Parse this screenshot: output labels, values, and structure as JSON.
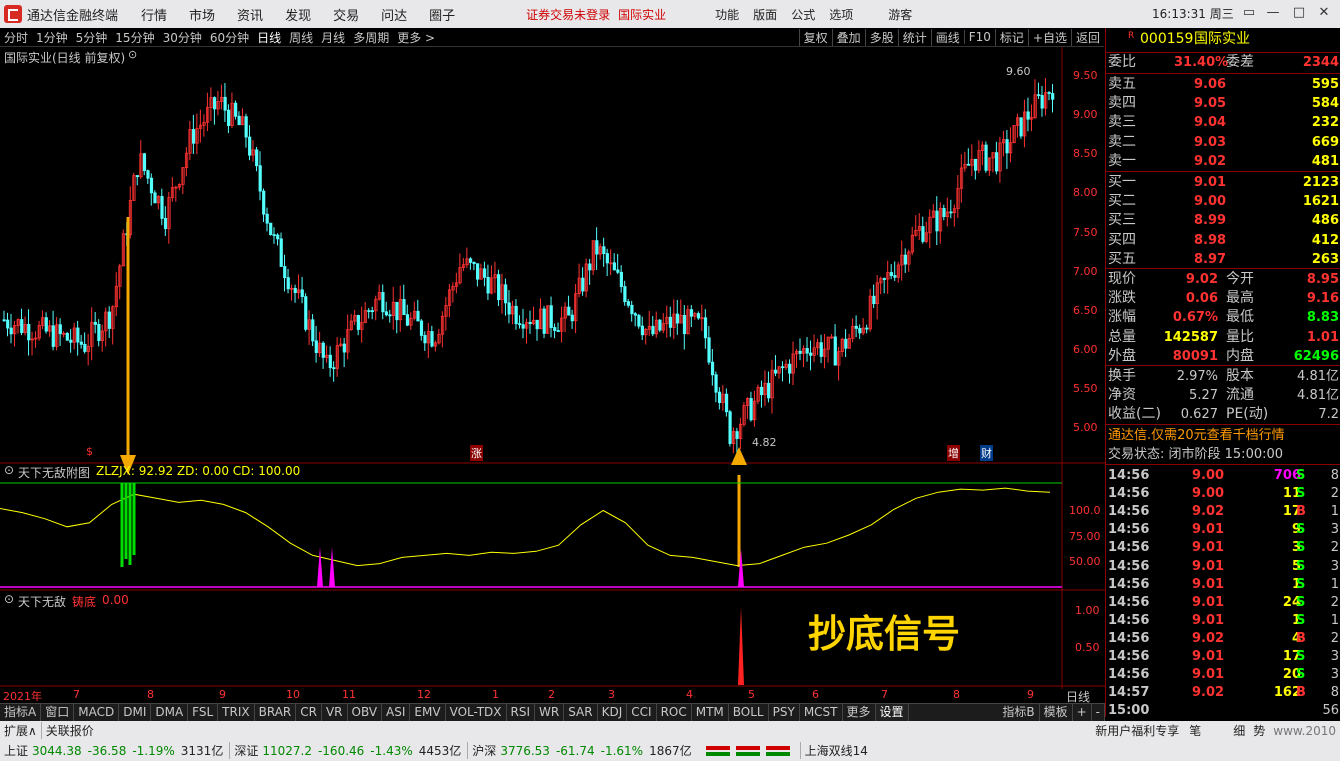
{
  "menubar": {
    "app_title": "通达信金融终端",
    "items": [
      "行情",
      "市场",
      "资讯",
      "发现",
      "交易",
      "问达",
      "圈子"
    ],
    "warning": "证券交易未登录",
    "stock_link": "国际实业",
    "right_items": [
      "功能",
      "版面",
      "公式",
      "选项"
    ],
    "guest": "游客",
    "clock": "16:13:31 周三",
    "win_buttons": [
      "▭",
      "—",
      "□",
      "✕"
    ]
  },
  "toolbar": {
    "periods": [
      "分时",
      "1分钟",
      "5分钟",
      "15分钟",
      "30分钟",
      "60分钟",
      "日线",
      "周线",
      "月线",
      "多周期",
      "更多 >"
    ],
    "active_period": "日线",
    "tools": [
      "复权",
      "叠加",
      "多股",
      "统计",
      "画线",
      "F10",
      "标记",
      "+自选",
      "返回"
    ]
  },
  "chart": {
    "title": "国际实业(日线 前复权)",
    "price_axis": [
      "9.50",
      "9.00",
      "8.50",
      "8.00",
      "7.50",
      "7.00",
      "6.50",
      "6.00",
      "5.50",
      "5.00"
    ],
    "high_label": "9.60",
    "low_label": "4.82",
    "event_markers": [
      "$",
      "涨",
      "增",
      "财"
    ],
    "sub1_title": "天下无敌附图",
    "sub1_values": "ZLZJX: 92.92  ZD: 0.00  CD: 100.00",
    "sub1_axis": [
      "100.0",
      "75.00",
      "50.00"
    ],
    "sub2_title": "天下无敌",
    "sub2_name": "铸底",
    "sub2_value": "0.00",
    "sub2_axis": [
      "1.00",
      "0.50"
    ],
    "signal_text": "抄底信号",
    "date_axis": [
      "2021年",
      "7",
      "8",
      "9",
      "10",
      "11",
      "12",
      "1",
      "2",
      "3",
      "4",
      "5",
      "6",
      "7",
      "8",
      "9"
    ],
    "period_label": "日线"
  },
  "chart_data": {
    "type": "candlestick",
    "title": "国际实业(日线 前复权)",
    "ylim": [
      4.8,
      9.75
    ],
    "high": 9.6,
    "low": 4.82,
    "x_labels": [
      "2021年",
      "7",
      "8",
      "9",
      "10",
      "11",
      "12",
      "1",
      "2",
      "3",
      "4",
      "5",
      "6",
      "7",
      "8",
      "9"
    ],
    "close_trend": [
      6.3,
      6.2,
      6.1,
      6.0,
      6.4,
      8.3,
      7.6,
      8.6,
      9.0,
      8.6,
      7.3,
      6.5,
      5.7,
      6.2,
      6.6,
      6.3,
      6.1,
      7.0,
      6.8,
      6.4,
      6.3,
      6.3,
      7.2,
      6.7,
      6.1,
      6.3,
      6.2,
      4.9,
      5.3,
      5.7,
      6.0,
      5.9,
      6.3,
      6.9,
      7.4,
      7.6,
      8.3,
      8.3,
      8.8,
      9.2
    ]
  },
  "quote": {
    "code": "000159",
    "name": "国际实业",
    "r_tag": "R",
    "weibi_label": "委比",
    "weibi": "31.40%",
    "weicha_label": "委差",
    "weicha": "2344",
    "asks": [
      {
        "label": "卖五",
        "price": "9.06",
        "vol": "595"
      },
      {
        "label": "卖四",
        "price": "9.05",
        "vol": "584"
      },
      {
        "label": "卖三",
        "price": "9.04",
        "vol": "232"
      },
      {
        "label": "卖二",
        "price": "9.03",
        "vol": "669"
      },
      {
        "label": "卖一",
        "price": "9.02",
        "vol": "481"
      }
    ],
    "bids": [
      {
        "label": "买一",
        "price": "9.01",
        "vol": "2123"
      },
      {
        "label": "买二",
        "price": "9.00",
        "vol": "1621"
      },
      {
        "label": "买三",
        "price": "8.99",
        "vol": "486"
      },
      {
        "label": "买四",
        "price": "8.98",
        "vol": "412"
      },
      {
        "label": "买五",
        "price": "8.97",
        "vol": "263"
      }
    ],
    "stats": [
      {
        "l1": "现价",
        "v1": "9.02",
        "l2": "今开",
        "v2": "8.95"
      },
      {
        "l1": "涨跌",
        "v1": "0.06",
        "l2": "最高",
        "v2": "9.16"
      },
      {
        "l1": "涨幅",
        "v1": "0.67%",
        "l2": "最低",
        "v2": "8.83"
      },
      {
        "l1": "总量",
        "v1": "142587",
        "l2": "量比",
        "v2": "1.01"
      },
      {
        "l1": "外盘",
        "v1": "80091",
        "l2": "内盘",
        "v2": "62496"
      }
    ],
    "stats2": [
      {
        "l1": "换手",
        "v1": "2.97%",
        "l2": "股本",
        "v2": "4.81亿"
      },
      {
        "l1": "净资",
        "v1": "5.27",
        "l2": "流通",
        "v2": "4.81亿"
      },
      {
        "l1": "收益(二)",
        "v1": "0.627",
        "l2": "PE(动)",
        "v2": "7.2"
      }
    ],
    "promo": "通达信.仅需20元查看千档行情",
    "trade_status": "交易状态: 闭市阶段 15:00:00",
    "ticks": [
      {
        "t": "14:56",
        "p": "9.00",
        "v": "706",
        "bs": "S",
        "n": "8"
      },
      {
        "t": "14:56",
        "p": "9.00",
        "v": "11",
        "bs": "S",
        "n": "2"
      },
      {
        "t": "14:56",
        "p": "9.02",
        "v": "17",
        "bs": "B",
        "n": "1"
      },
      {
        "t": "14:56",
        "p": "9.01",
        "v": "9",
        "bs": "S",
        "n": "3"
      },
      {
        "t": "14:56",
        "p": "9.01",
        "v": "3",
        "bs": "S",
        "n": "2"
      },
      {
        "t": "14:56",
        "p": "9.01",
        "v": "5",
        "bs": "S",
        "n": "3"
      },
      {
        "t": "14:56",
        "p": "9.01",
        "v": "1",
        "bs": "S",
        "n": "1"
      },
      {
        "t": "14:56",
        "p": "9.01",
        "v": "24",
        "bs": "S",
        "n": "2"
      },
      {
        "t": "14:56",
        "p": "9.01",
        "v": "1",
        "bs": "S",
        "n": "1"
      },
      {
        "t": "14:56",
        "p": "9.02",
        "v": "4",
        "bs": "B",
        "n": "2"
      },
      {
        "t": "14:56",
        "p": "9.01",
        "v": "17",
        "bs": "S",
        "n": "3"
      },
      {
        "t": "14:56",
        "p": "9.01",
        "v": "20",
        "bs": "S",
        "n": "3"
      },
      {
        "t": "14:57",
        "p": "9.02",
        "v": "162",
        "bs": "B",
        "n": "8"
      },
      {
        "t": "15:00",
        "p": "",
        "v": "",
        "bs": "",
        "n": "56"
      }
    ]
  },
  "bottom_tabs": [
    "指标A",
    "窗口",
    "MACD",
    "DMI",
    "DMA",
    "FSL",
    "TRIX",
    "BRAR",
    "CR",
    "VR",
    "OBV",
    "ASI",
    "EMV",
    "VOL-TDX",
    "RSI",
    "WR",
    "SAR",
    "KDJ",
    "CCI",
    "ROC",
    "MTM",
    "BOLL",
    "PSY",
    "MCST",
    "更多",
    "设置"
  ],
  "bottom_right_tabs": [
    "指标B",
    "模板",
    "+",
    "-"
  ],
  "extbar": {
    "expand": "扩展∧",
    "related": "关联报价",
    "promo": "新用户福利专享",
    "pen": "笔",
    "detail": "细",
    "trend": "势",
    "watermark": "www.2010"
  },
  "statusbar": {
    "items": [
      {
        "name": "上证",
        "idx": "3044.38",
        "chg": "-36.58",
        "pct": "-1.19%",
        "amt": "3131亿"
      },
      {
        "name": "深证",
        "idx": "11027.2",
        "chg": "-160.46",
        "pct": "-1.43%",
        "amt": "4453亿"
      },
      {
        "name": "沪深",
        "idx": "3776.53",
        "chg": "-61.74",
        "pct": "-1.61%",
        "amt": "1867亿"
      }
    ],
    "ticker": "上海双线14"
  },
  "colors": {
    "up": "#ff3232",
    "down": "#54ffff",
    "bg": "#000000",
    "grid": "#8a0000",
    "yellow": "#ffff00",
    "arrow": "#f5a800"
  }
}
